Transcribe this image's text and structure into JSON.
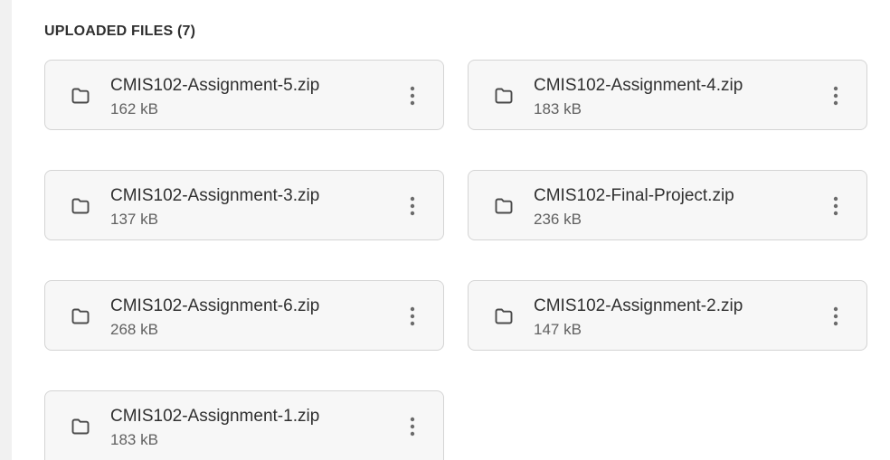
{
  "section": {
    "title": "UPLOADED FILES (7)"
  },
  "files": [
    {
      "name": "CMIS102-Assignment-5.zip",
      "size": "162 kB",
      "icon": "folder-icon",
      "menu_icon": "more-vertical-icon"
    },
    {
      "name": "CMIS102-Assignment-4.zip",
      "size": "183 kB",
      "icon": "folder-icon",
      "menu_icon": "more-vertical-icon"
    },
    {
      "name": "CMIS102-Assignment-3.zip",
      "size": "137 kB",
      "icon": "folder-icon",
      "menu_icon": "more-vertical-icon"
    },
    {
      "name": "CMIS102-Final-Project.zip",
      "size": "236 kB",
      "icon": "folder-icon",
      "menu_icon": "more-vertical-icon"
    },
    {
      "name": "CMIS102-Assignment-6.zip",
      "size": "268 kB",
      "icon": "folder-icon",
      "menu_icon": "more-vertical-icon"
    },
    {
      "name": "CMIS102-Assignment-2.zip",
      "size": "147 kB",
      "icon": "folder-icon",
      "menu_icon": "more-vertical-icon"
    },
    {
      "name": "CMIS102-Assignment-1.zip",
      "size": "183 kB",
      "icon": "folder-icon",
      "menu_icon": "more-vertical-icon"
    }
  ],
  "colors": {
    "card_background": "#f7f7f7",
    "card_border": "#d4d4d4",
    "text_primary": "#303030",
    "text_secondary": "#616161",
    "icon": "#4a4a4a"
  }
}
